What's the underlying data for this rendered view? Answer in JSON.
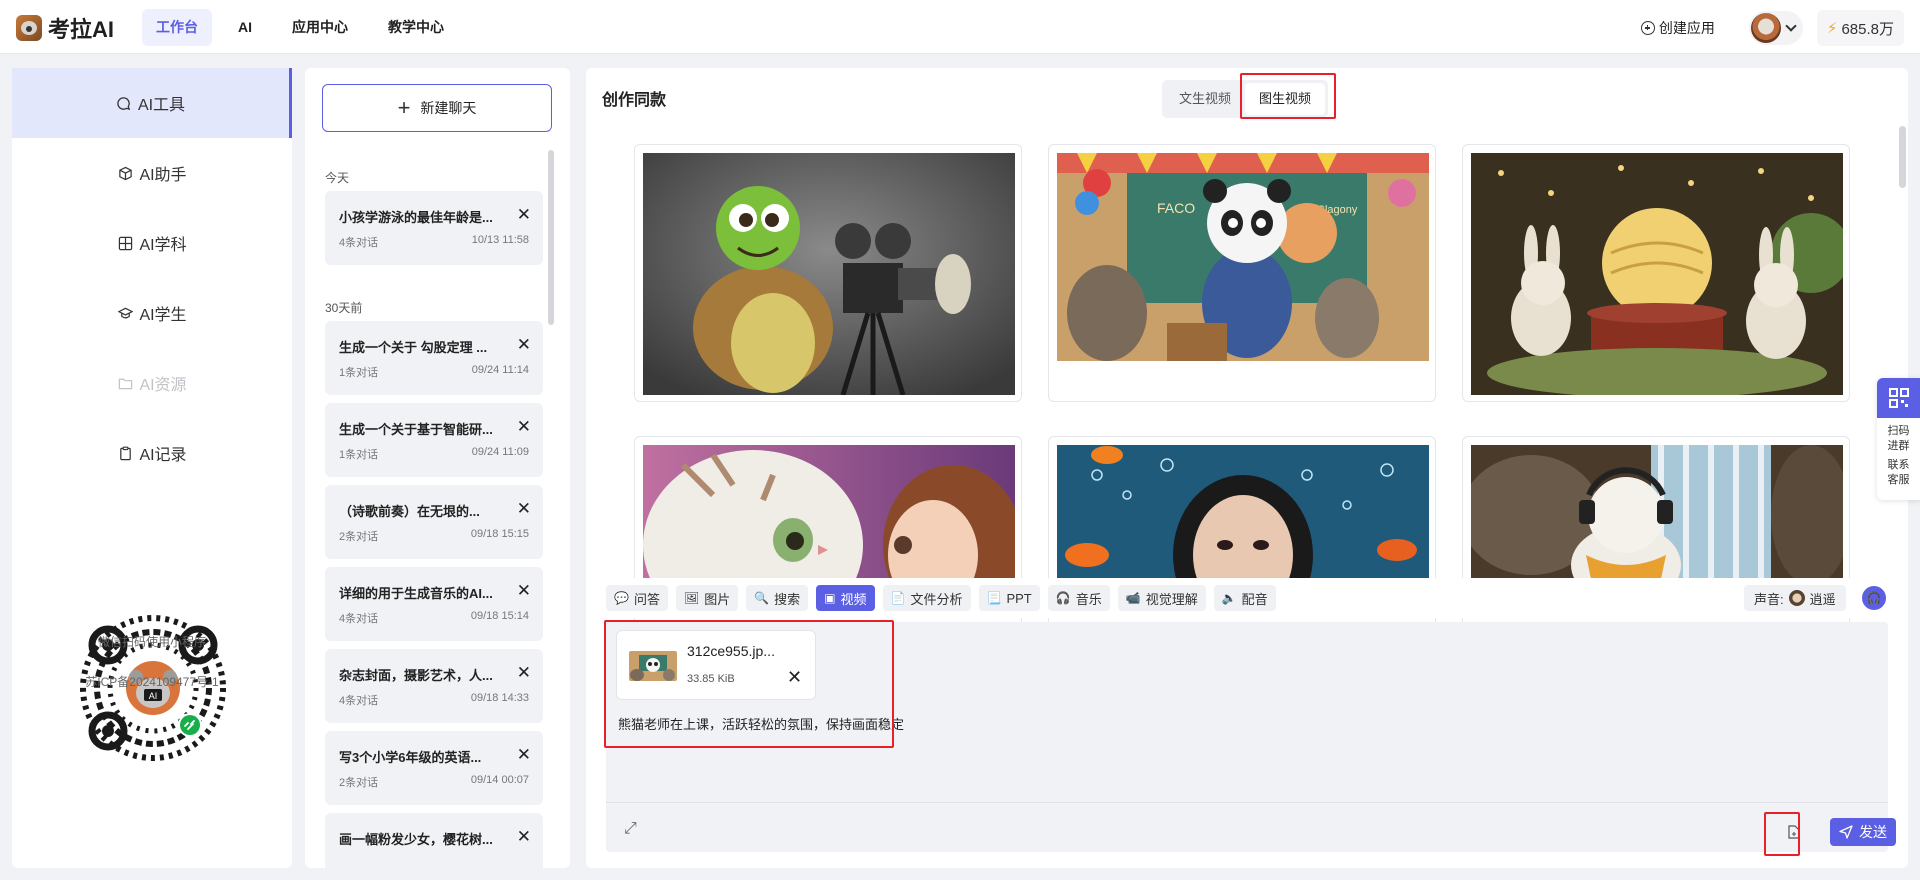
{
  "app": {
    "name": "考拉AI"
  },
  "nav": [
    {
      "label": "工作台",
      "active": true
    },
    {
      "label": "AI"
    },
    {
      "label": "应用中心"
    },
    {
      "label": "教学中心"
    }
  ],
  "topbar": {
    "create_app": "创建应用",
    "points": "685.8万"
  },
  "sidebar": {
    "items": [
      {
        "label": "AI工具",
        "icon": "chat-bubble-icon",
        "active": true
      },
      {
        "label": "AI助手",
        "icon": "cube-icon"
      },
      {
        "label": "AI学科",
        "icon": "grid-icon"
      },
      {
        "label": "AI学生",
        "icon": "graduation-cap-icon"
      },
      {
        "label": "AI资源",
        "icon": "folder-icon",
        "disabled": true
      },
      {
        "label": "AI记录",
        "icon": "clipboard-icon"
      }
    ],
    "qr_caption": "微信扫码使用小程序",
    "icp": "苏ICP备2024109477号-1"
  },
  "chats": {
    "new_chat": "新建聊天",
    "groups": [
      {
        "label": "今天",
        "items": [
          {
            "title": "小孩学游泳的最佳年龄是...",
            "count": "4条对话",
            "time": "10/13 11:58"
          }
        ]
      },
      {
        "label": "30天前",
        "items": [
          {
            "title": "生成一个关于 勾股定理 ...",
            "count": "1条对话",
            "time": "09/24 11:14"
          },
          {
            "title": "生成一个关于基于智能研...",
            "count": "1条对话",
            "time": "09/24 11:09"
          },
          {
            "title": "（诗歌前奏）在无垠的...",
            "count": "2条对话",
            "time": "09/18 15:15"
          },
          {
            "title": "详细的用于生成音乐的AI...",
            "count": "4条对话",
            "time": "09/18 15:14"
          },
          {
            "title": "杂志封面，摄影艺术，人...",
            "count": "4条对话",
            "time": "09/18 14:33"
          },
          {
            "title": "写3个小学6年级的英语...",
            "count": "2条对话",
            "time": "09/14 00:07"
          },
          {
            "title": "画一幅粉发少女，樱花树...",
            "count": "",
            "time": ""
          }
        ]
      }
    ]
  },
  "main": {
    "title": "创作同款",
    "tabs": [
      {
        "label": "文生视频"
      },
      {
        "label": "图生视频",
        "active": true
      }
    ],
    "gallery": [
      {
        "name": "turtle-camera-image"
      },
      {
        "name": "panda-classroom-image"
      },
      {
        "name": "rabbits-mooncake-image"
      },
      {
        "name": "cat-girl-image"
      },
      {
        "name": "underwater-girl-image"
      },
      {
        "name": "polar-bear-waterfall-image"
      }
    ]
  },
  "toolbar": {
    "items": [
      {
        "label": "问答",
        "icon": "chat-icon"
      },
      {
        "label": "图片",
        "icon": "image-icon"
      },
      {
        "label": "搜索",
        "icon": "search-icon"
      },
      {
        "label": "视频",
        "icon": "video-icon",
        "active": true
      },
      {
        "label": "文件分析",
        "icon": "file-icon"
      },
      {
        "label": "PPT",
        "icon": "ppt-icon"
      },
      {
        "label": "音乐",
        "icon": "headphones-icon"
      },
      {
        "label": "视觉理解",
        "icon": "camera-icon"
      },
      {
        "label": "配音",
        "icon": "speaker-icon"
      }
    ],
    "voice_label": "声音:",
    "voice_name": "逍遥"
  },
  "composer": {
    "attachment": {
      "name": "312ce955.jp...",
      "size": "33.85 KiB"
    },
    "prompt": "熊猫老师在上课，活跃轻松的氛围，保持画面稳定",
    "send_label": "发送"
  },
  "float": {
    "line1": "扫码",
    "line2": "进群",
    "line3": "联系",
    "line4": "客服"
  },
  "colors": {
    "accent": "#5b5fe4",
    "highlight": "#e8202a"
  }
}
